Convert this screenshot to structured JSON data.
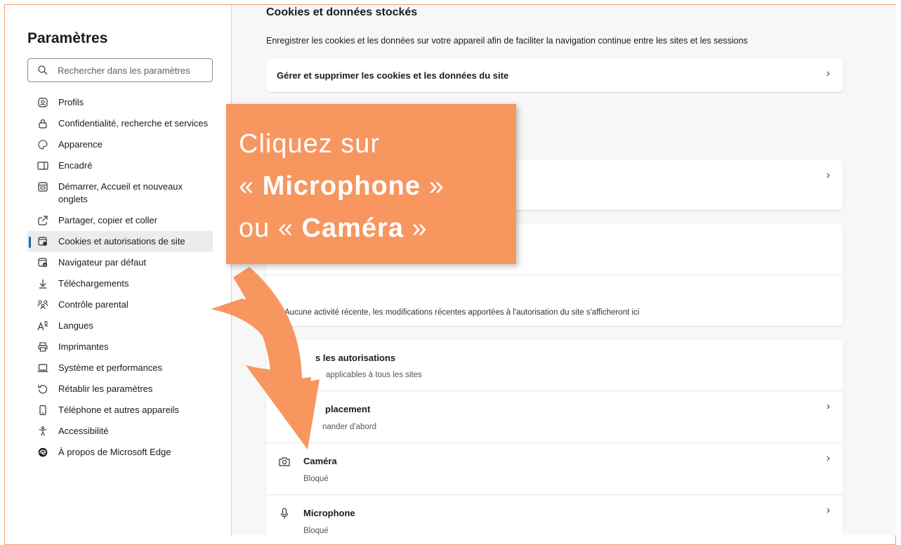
{
  "sidebar": {
    "title": "Paramètres",
    "search_placeholder": "Rechercher dans les paramètres",
    "items": [
      {
        "label": "Profils",
        "icon": "profile-icon"
      },
      {
        "label": "Confidentialité, recherche et services",
        "icon": "lock-icon"
      },
      {
        "label": "Apparence",
        "icon": "palette-icon"
      },
      {
        "label": "Encadré",
        "icon": "sidebar-icon"
      },
      {
        "label": "Démarrer, Accueil et nouveaux onglets",
        "icon": "home-tab-icon"
      },
      {
        "label": "Partager, copier et coller",
        "icon": "share-icon"
      },
      {
        "label": "Cookies et autorisations de site",
        "icon": "cookie-settings-icon"
      },
      {
        "label": "Navigateur par défaut",
        "icon": "default-browser-icon"
      },
      {
        "label": "Téléchargements",
        "icon": "download-icon"
      },
      {
        "label": "Contrôle parental",
        "icon": "family-icon"
      },
      {
        "label": "Langues",
        "icon": "language-icon"
      },
      {
        "label": "Imprimantes",
        "icon": "printer-icon"
      },
      {
        "label": "Système et performances",
        "icon": "laptop-icon"
      },
      {
        "label": "Rétablir les paramètres",
        "icon": "reset-icon"
      },
      {
        "label": "Téléphone et autres appareils",
        "icon": "phone-icon"
      },
      {
        "label": "Accessibilité",
        "icon": "accessibility-icon"
      },
      {
        "label": "À propos de Microsoft Edge",
        "icon": "edge-logo-icon"
      }
    ],
    "active_index": 6
  },
  "main": {
    "section_title": "Cookies et données stockés",
    "section_desc": "Enregistrer les cookies et les données sur votre appareil afin de faciliter la navigation continue entre les sites et les sessions",
    "manage_cookies": "Gérer et supprimer les cookies et les données du site",
    "recent_activity": "Aucune activité récente, les modifications récentes apportées à l'autorisation du site s'afficheront ici",
    "all_permissions_title": "s les autorisations",
    "all_permissions_sub": "applicables à tous les sites",
    "location_title": "placement",
    "location_sub": "nander d'abord",
    "camera_title": "Caméra",
    "camera_sub": "Bloqué",
    "mic_title": "Microphone",
    "mic_sub": "Bloqué"
  },
  "callout": {
    "line1": "Cliquez sur",
    "line2_pre": "« ",
    "line2_bold": "Microphone",
    "line2_post": " »",
    "line3_pre": "ou « ",
    "line3_bold": "Caméra",
    "line3_post": " »"
  },
  "colors": {
    "accent": "#0f6cbd",
    "callout": "#f7965f",
    "frame": "#f0a070"
  }
}
